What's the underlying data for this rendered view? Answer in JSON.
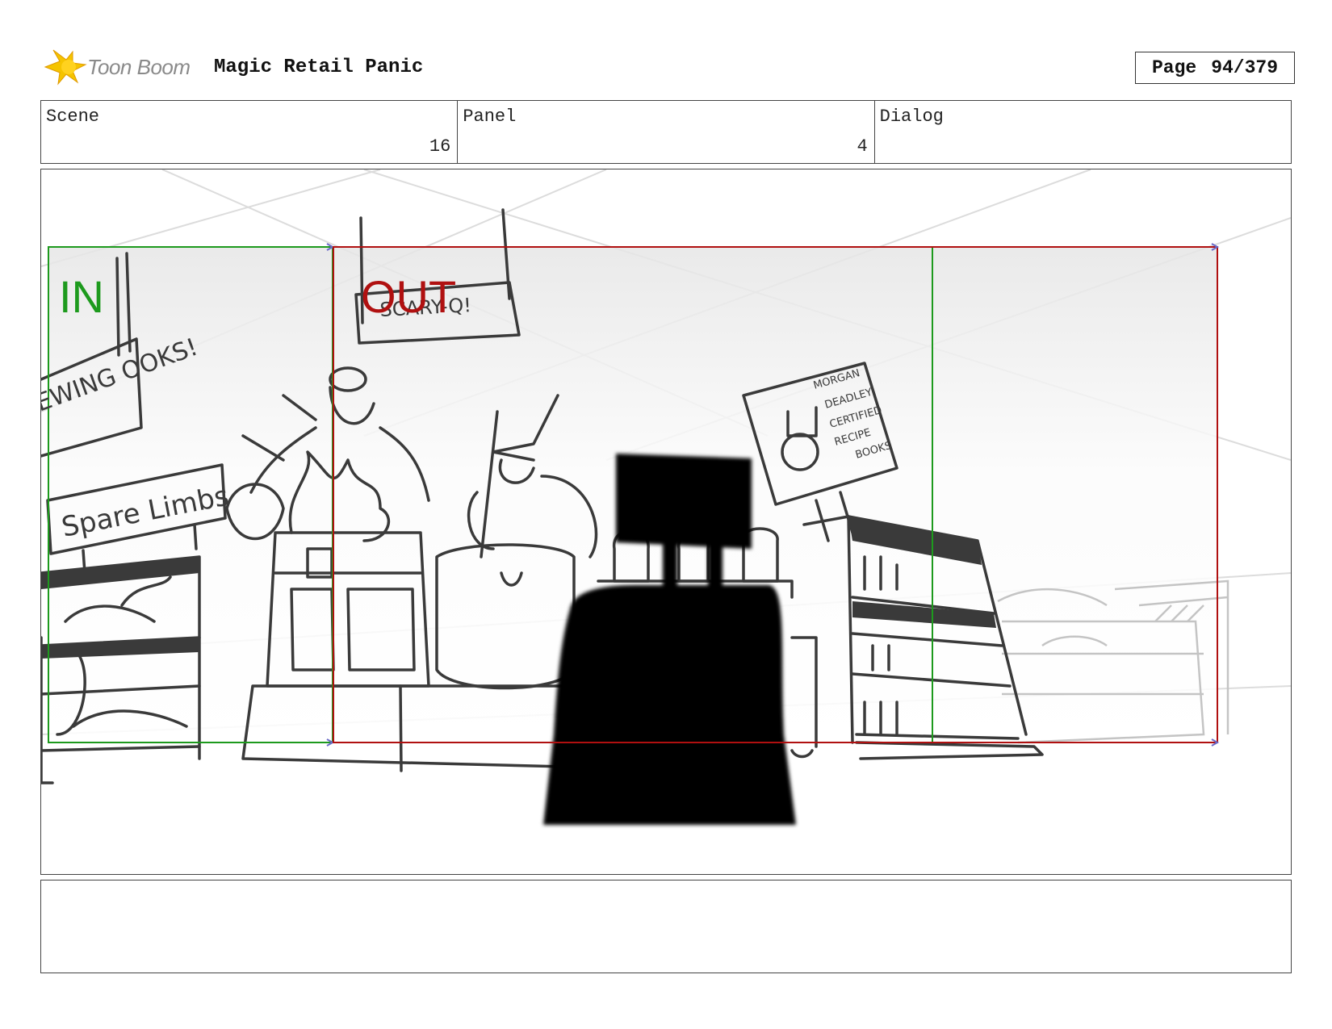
{
  "header": {
    "logo_text": "Toon Boom",
    "project_title": "Magic Retail Panic",
    "page_label": "Page",
    "page_number": "94/379"
  },
  "fields": {
    "scene_label": "Scene",
    "scene_value": "16",
    "panel_label": "Panel",
    "panel_value": "4",
    "dialog_label": "Dialog",
    "dialog_value": ""
  },
  "frame_marks": {
    "in_label": "IN",
    "out_label": "OUT"
  },
  "sketch_signs": {
    "sign_scary_q": "SCARY-Q!",
    "sign_spare_limbs": "Spare Limbs",
    "sign_brewing_books": "EWING OOKS!",
    "poster_line_1": "MORGAN",
    "poster_line_2": "DEADLEY",
    "poster_line_3": "CERTIFIED",
    "poster_line_4": "RECIPE",
    "poster_line_5": "BOOKS"
  },
  "colors": {
    "in_frame": "#1d9a1d",
    "out_frame": "#b01010",
    "logo_burst": "#f5c400",
    "silhouette": "#000000"
  },
  "notes": ""
}
